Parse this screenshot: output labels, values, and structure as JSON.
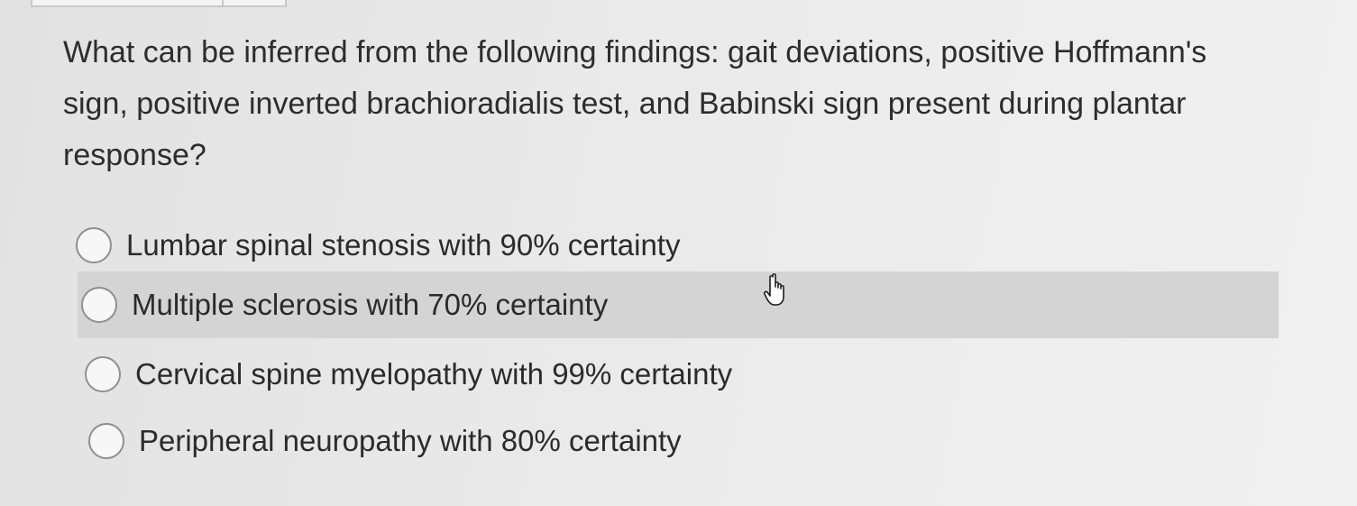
{
  "question": {
    "text": "What can be inferred from the following findings: gait deviations, positive Hoffmann's sign, positive inverted brachioradialis test, and Babinski sign present during plantar response?"
  },
  "options": [
    {
      "label": "Lumbar spinal stenosis with 90% certainty",
      "selected": false,
      "hovered": false
    },
    {
      "label": "Multiple sclerosis with 70% certainty",
      "selected": false,
      "hovered": true
    },
    {
      "label": "Cervical spine myelopathy with 99% certainty",
      "selected": false,
      "hovered": false
    },
    {
      "label": "Peripheral neuropathy with 80% certainty",
      "selected": false,
      "hovered": false
    }
  ],
  "cursor": {
    "icon": "hand-pointer-icon"
  },
  "colors": {
    "hover_background": "#d4d4d4",
    "text": "#2b2b2b",
    "radio_border": "#8f8f8f"
  }
}
